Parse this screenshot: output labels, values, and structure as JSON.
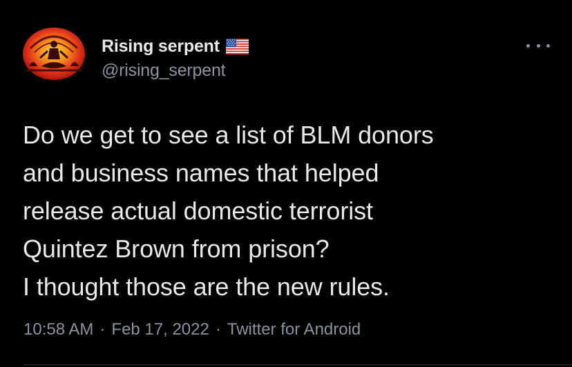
{
  "author": {
    "display_name": "Rising serpent",
    "handle": "@rising_serpent",
    "flag_icon": "us-flag-icon",
    "avatar_icon": "meditating-figure-avatar"
  },
  "menu": {
    "icon": "more-options-icon"
  },
  "tweet": {
    "text": "Do we get to see a list of BLM donors\nand business names that helped\nrelease actual domestic terrorist\nQuintez Brown from prison?\nI thought those are the new rules."
  },
  "meta": {
    "time": "10:58 AM",
    "date": "Feb 17, 2022",
    "source": "Twitter for Android",
    "separator": "·"
  },
  "colors": {
    "background": "#000000",
    "primary_text": "#e7e9ea",
    "secondary_text": "#8b949c",
    "avatar_red": "#e0321a",
    "avatar_orange": "#f79a1c"
  }
}
